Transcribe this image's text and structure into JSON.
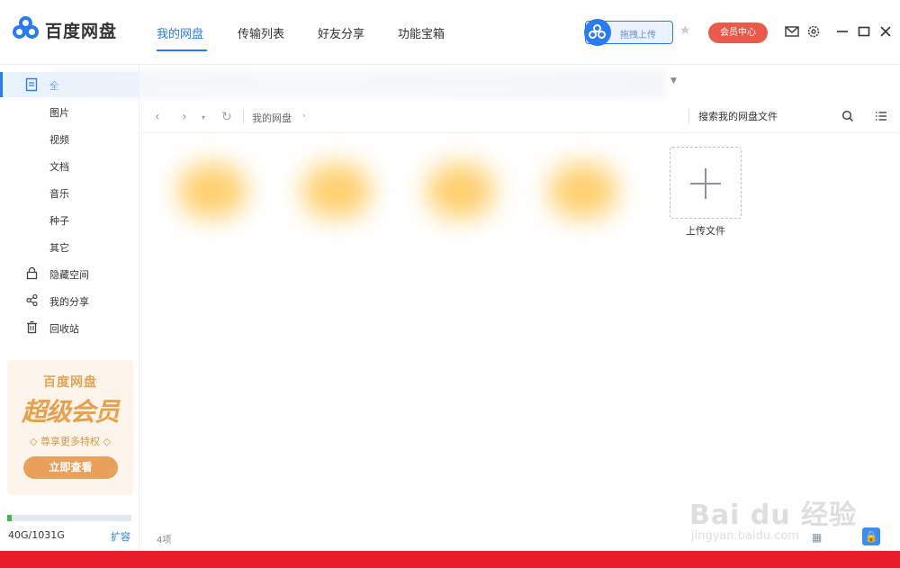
{
  "app": {
    "name": "百度网盘"
  },
  "nav": {
    "tabs": [
      {
        "label": "我的网盘",
        "active": true
      },
      {
        "label": "传输列表",
        "active": false
      },
      {
        "label": "好友分享",
        "active": false
      },
      {
        "label": "功能宝箱",
        "active": false
      }
    ]
  },
  "header": {
    "upload_pill_label": "拖拽上传",
    "vip_label": "会员中心"
  },
  "sidebar": {
    "selected_label": "全",
    "sub_items": [
      "图片",
      "视频",
      "文档",
      "音乐",
      "种子",
      "其它"
    ],
    "items": [
      {
        "label": "隐藏空间",
        "icon": "lock-icon"
      },
      {
        "label": "我的分享",
        "icon": "share-icon"
      },
      {
        "label": "回收站",
        "icon": "trash-icon"
      }
    ]
  },
  "promo": {
    "brand": "百度网盘",
    "title": "超级会员",
    "subtitle": "◇ 尊享更多特权 ◇",
    "button_label": "立即查看"
  },
  "quota": {
    "text": "40G/1031G",
    "used_fraction": 0.039,
    "expand_label": "扩容"
  },
  "toolbar": {
    "breadcrumb": "我的网盘",
    "search_placeholder": "搜索我的网盘文件"
  },
  "content": {
    "upload_tile_label": "上传文件",
    "item_count": "4项"
  },
  "watermark": {
    "main": "Bai du 经验",
    "sub": "jingyan.baidu.com"
  },
  "colors": {
    "accent": "#2b7bf0",
    "vip": "#ea5a4a",
    "promo": "#e9a05a",
    "bottom_bar": "#e81d2c"
  }
}
